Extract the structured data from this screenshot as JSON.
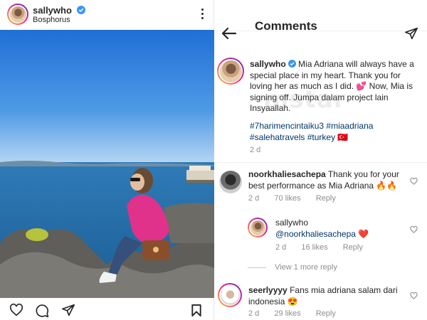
{
  "post": {
    "username": "sallywho",
    "location": "Bosphorus"
  },
  "comments_panel": {
    "title": "Comments",
    "caption": {
      "username": "sallywho",
      "text": "Mia Adriana will always have a special place in my heart. Thank you for loving her as much as I did. 💕 Now, Mia is signing off. Jumpa dalam project lain Insyaallah.",
      "hashtags": "#7harimencintaiku3 #miaadriana #salehatravels #turkey 🇹🇷",
      "time": "2 d"
    },
    "comments": [
      {
        "username": "noorkhaliesachepa",
        "text": "Thank you for your best performance as Mia Adriana 🔥🔥",
        "time": "2 d",
        "likes": "70 likes",
        "reply": "Reply"
      },
      {
        "username": "sallywho",
        "mention": "@noorkhaliesachepa",
        "emoji": "❤️",
        "time": "2 d",
        "likes": "16 likes",
        "reply": "Reply"
      },
      {
        "username": "seerlyyyy",
        "text": "Fans mia adriana salam dari indonesia 😍",
        "time": "2 d",
        "likes": "29 likes",
        "reply": "Reply"
      }
    ],
    "view_more": "View 1 more reply"
  },
  "watermark": "mstar",
  "colors": {
    "verified": "#3897f0",
    "link": "#00376b",
    "meta": "#8e8e8e"
  },
  "icons": [
    "verified-badge-icon",
    "more-options-icon",
    "heart-icon",
    "comment-icon",
    "share-icon",
    "bookmark-icon",
    "back-arrow-icon",
    "direct-message-icon"
  ]
}
